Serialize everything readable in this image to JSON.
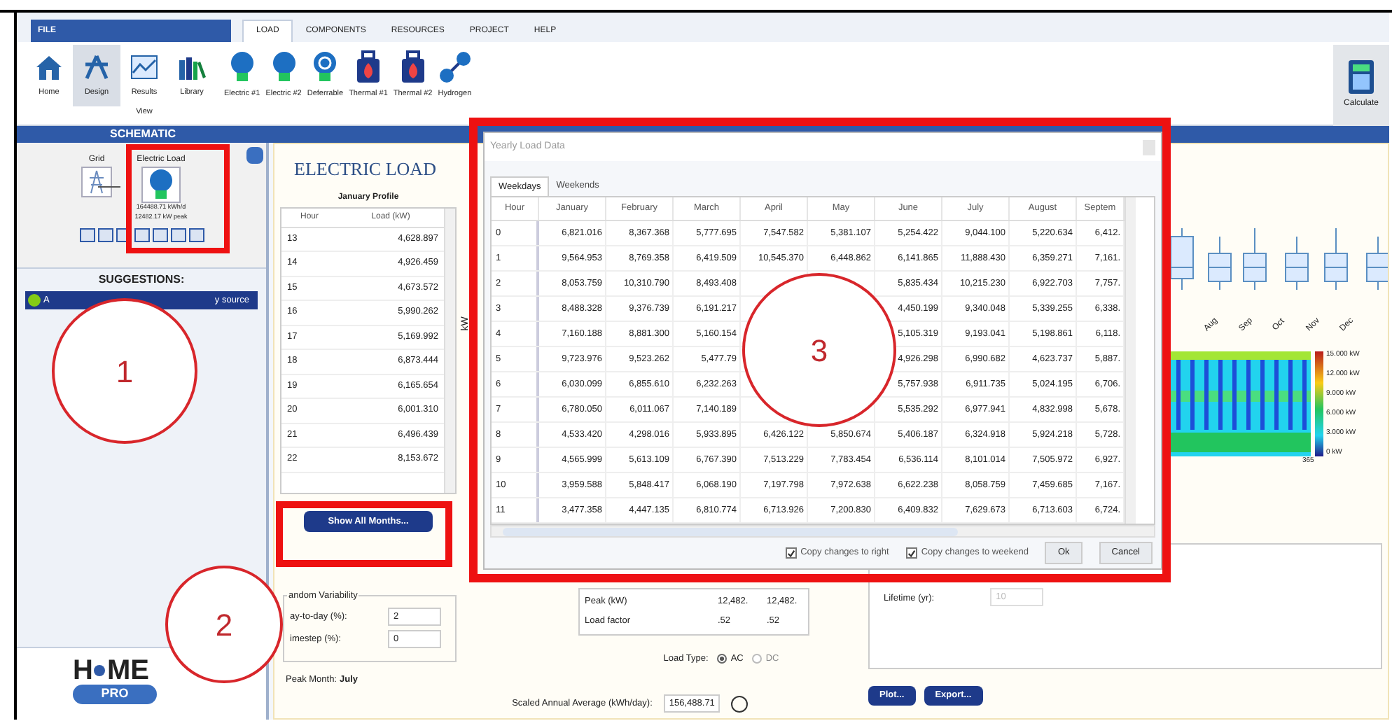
{
  "ribbon_tabs": [
    {
      "label": "FILE",
      "kind": "file",
      "selected": false
    },
    {
      "label": "LOAD",
      "kind": "tab",
      "selected": true
    },
    {
      "label": "COMPONENTS",
      "kind": "tab",
      "selected": false
    },
    {
      "label": "RESOURCES",
      "kind": "tab",
      "selected": false
    },
    {
      "label": "PROJECT",
      "kind": "tab",
      "selected": false
    },
    {
      "label": "HELP",
      "kind": "tab",
      "selected": false
    }
  ],
  "view_buttons": [
    {
      "label": "Home",
      "selected": false
    },
    {
      "label": "Design",
      "selected": true
    },
    {
      "label": "Results",
      "selected": false
    },
    {
      "label": "Library",
      "selected": false
    }
  ],
  "view_group_label": "View",
  "load_buttons": [
    "Electric #1",
    "Electric #2",
    "Deferrable",
    "Thermal #1",
    "Thermal #2",
    "Hydrogen"
  ],
  "calculate_button": "Calculate",
  "schematic": {
    "title": "SCHEMATIC",
    "grid_label": "Grid",
    "load_label": "Electric Load",
    "load_energy": "164488.71 kWh/d",
    "load_peak": "12482.17 kW peak"
  },
  "suggestions": {
    "title": "SUGGESTIONS:",
    "items": [
      {
        "text_start": "A",
        "text_end": "y source"
      }
    ]
  },
  "logo": {
    "left": "H",
    "right": "ME",
    "badge": "PRO"
  },
  "electric_load": {
    "title": "ELECTRIC LOAD",
    "profile_title": "January Profile",
    "columns": [
      "Hour",
      "Load (kW)"
    ],
    "axis_label": "kW",
    "rows": [
      [
        "13",
        "4,628.897"
      ],
      [
        "14",
        "4,926.459"
      ],
      [
        "15",
        "4,673.572"
      ],
      [
        "16",
        "5,990.262"
      ],
      [
        "17",
        "5,169.992"
      ],
      [
        "18",
        "6,873.444"
      ],
      [
        "19",
        "6,165.654"
      ],
      [
        "20",
        "6,001.310"
      ],
      [
        "21",
        "6,496.439"
      ],
      [
        "22",
        "8,153.672"
      ]
    ]
  },
  "show_all_button": "Show All Months...",
  "variability": {
    "title": "andom Variability",
    "fields": [
      {
        "label": "ay-to-day (%):",
        "value": "2"
      },
      {
        "label": "imestep (%):",
        "value": "0"
      }
    ]
  },
  "peak_month": {
    "label": "Peak Month:",
    "value": "July"
  },
  "stats": {
    "rows": [
      [
        "Peak (kW)",
        "12,482.",
        "12,482."
      ],
      [
        "Load factor",
        ".52",
        ".52"
      ]
    ]
  },
  "load_type": {
    "label": "Load Type:",
    "options": [
      {
        "label": "AC",
        "selected": true
      },
      {
        "label": "DC",
        "selected": false
      }
    ]
  },
  "lifetime": {
    "label": "Lifetime (yr):",
    "value": "10"
  },
  "action_buttons": [
    "Plot...",
    "Export..."
  ],
  "scaled_average": {
    "label": "Scaled Annual Average (kWh/day):",
    "value": "156,488.71"
  },
  "chart_strip": {
    "months": [
      "Aug",
      "Sep",
      "Oct",
      "Nov",
      "Dec"
    ],
    "colorbar": [
      "15.000 kW",
      "12.000 kW",
      "9.000 kW",
      "6.000 kW",
      "3.000 kW",
      "0 kW"
    ],
    "day_end": "365"
  },
  "dialog": {
    "title": "Yearly Load Data",
    "tabs": [
      {
        "label": "Weekdays",
        "selected": true
      },
      {
        "label": "Weekends",
        "selected": false
      }
    ],
    "columns": [
      "Hour",
      "January",
      "February",
      "March",
      "April",
      "May",
      "June",
      "July",
      "August",
      "Septem"
    ],
    "rows": [
      [
        "0",
        "6,821.016",
        "8,367.368",
        "5,777.695",
        "7,547.582",
        "5,381.107",
        "5,254.422",
        "9,044.100",
        "5,220.634",
        "6,412."
      ],
      [
        "1",
        "9,564.953",
        "8,769.358",
        "6,419.509",
        "10,545.370",
        "6,448.862",
        "6,141.865",
        "11,888.430",
        "6,359.271",
        "7,161."
      ],
      [
        "2",
        "8,053.759",
        "10,310.790",
        "8,493.408",
        null,
        null,
        "5,835.434",
        "10,215.230",
        "6,922.703",
        "7,757."
      ],
      [
        "3",
        "8,488.328",
        "9,376.739",
        "6,191.217",
        null,
        null,
        "4,450.199",
        "9,340.048",
        "5,339.255",
        "6,338."
      ],
      [
        "4",
        "7,160.188",
        "8,881.300",
        "5,160.154",
        null,
        null,
        "5,105.319",
        "9,193.041",
        "5,198.861",
        "6,118."
      ],
      [
        "5",
        "9,723.976",
        "9,523.262",
        "5,477.79",
        null,
        null,
        "4,926.298",
        "6,990.682",
        "4,623.737",
        "5,887."
      ],
      [
        "6",
        "6,030.099",
        "6,855.610",
        "6,232.263",
        null,
        null,
        "5,757.938",
        "6,911.735",
        "5,024.195",
        "6,706."
      ],
      [
        "7",
        "6,780.050",
        "6,011.067",
        "7,140.189",
        null,
        null,
        "5,535.292",
        "6,977.941",
        "4,832.998",
        "5,678."
      ],
      [
        "8",
        "4,533.420",
        "4,298.016",
        "5,933.895",
        "6,426.122",
        "5,850.674",
        "5,406.187",
        "6,324.918",
        "5,924.218",
        "5,728."
      ],
      [
        "9",
        "4,565.999",
        "5,613.109",
        "6,767.390",
        "7,513.229",
        "7,783.454",
        "6,536.114",
        "8,101.014",
        "7,505.972",
        "6,927."
      ],
      [
        "10",
        "3,959.588",
        "5,848.417",
        "6,068.190",
        "7,197.798",
        "7,972.638",
        "6,622.238",
        "8,058.759",
        "7,459.685",
        "7,167."
      ],
      [
        "11",
        "3,477.358",
        "4,447.135",
        "6,810.774",
        "6,713.926",
        "7,200.830",
        "6,409.832",
        "7,629.673",
        "6,713.603",
        "6,724."
      ]
    ],
    "checkboxes": [
      {
        "label": "Copy changes to right",
        "checked": true
      },
      {
        "label": "Copy changes to weekend",
        "checked": true
      }
    ],
    "buttons": [
      "Ok",
      "Cancel"
    ]
  },
  "annotations": [
    {
      "label": "1"
    },
    {
      "label": "2"
    },
    {
      "label": "3"
    }
  ]
}
